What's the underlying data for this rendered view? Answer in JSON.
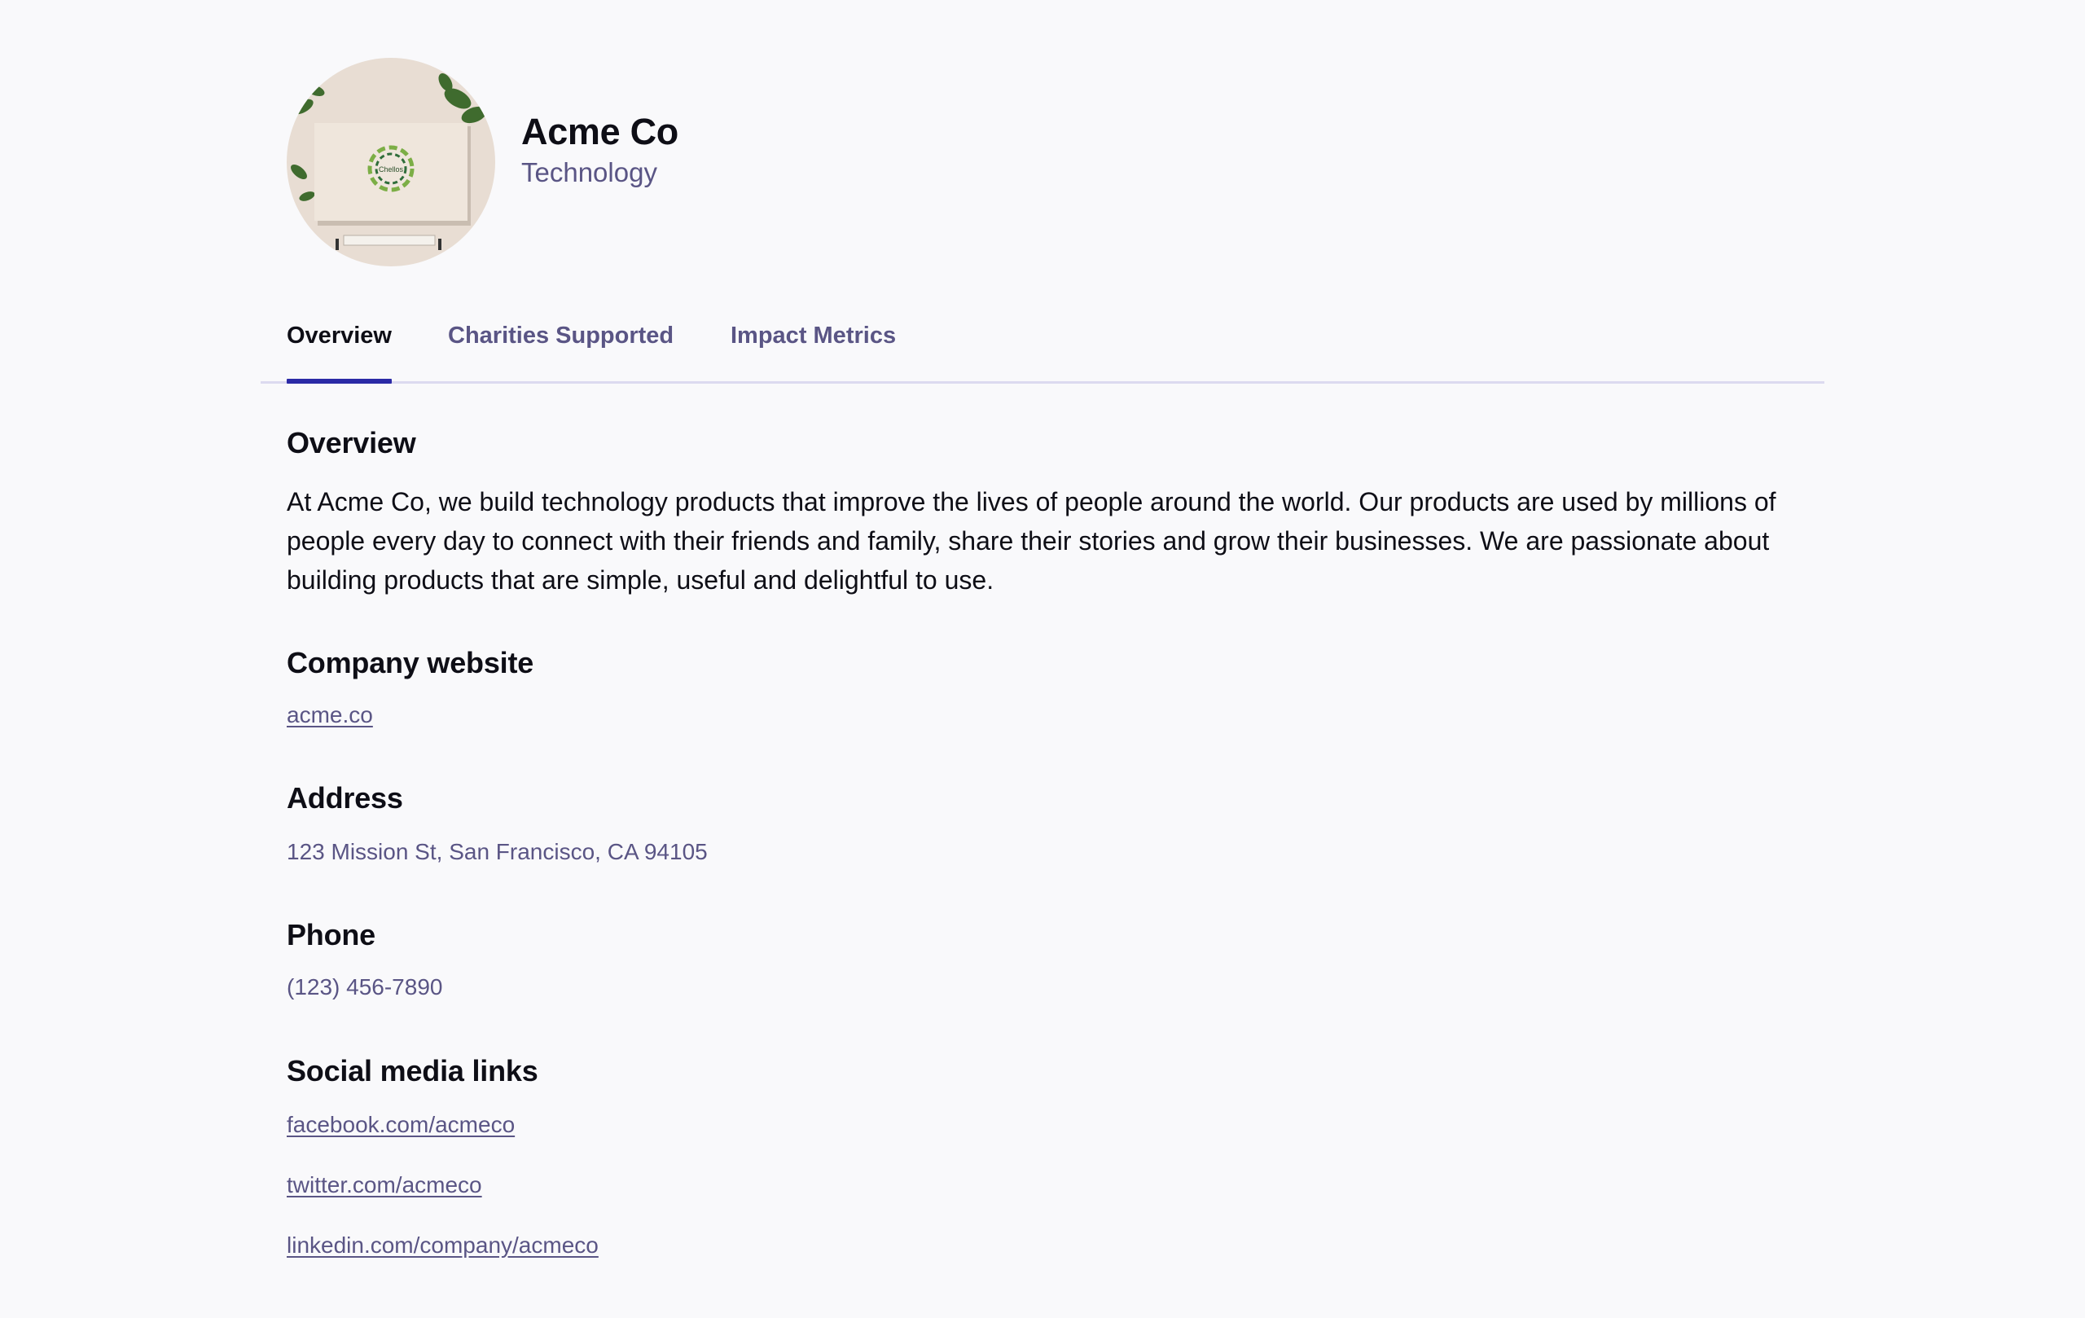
{
  "profile": {
    "name": "Acme Co",
    "category": "Technology",
    "logo_text": "Chellos"
  },
  "tabs": [
    {
      "label": "Overview",
      "active": true
    },
    {
      "label": "Charities Supported",
      "active": false
    },
    {
      "label": "Impact Metrics",
      "active": false
    }
  ],
  "overview": {
    "heading": "Overview",
    "text": "At Acme Co, we build technology products that improve the lives of people around the world. Our products are used by millions of people every day to connect with their friends and family, share their stories and grow their businesses. We are passionate about building products that are simple, useful and delightful to use."
  },
  "website": {
    "heading": "Company website",
    "link": "acme.co"
  },
  "address": {
    "heading": "Address",
    "value": "123 Mission St, San Francisco, CA 94105"
  },
  "phone": {
    "heading": "Phone",
    "value": "(123) 456-7890"
  },
  "social": {
    "heading": "Social media links",
    "links": [
      "facebook.com/acmeco",
      "twitter.com/acmeco",
      "linkedin.com/company/acmeco"
    ]
  },
  "colors": {
    "background": "#f9f9fb",
    "heading": "#0e0e16",
    "muted": "#5a5585",
    "accent": "#2b2aa6",
    "divider": "#dcdaf0"
  }
}
